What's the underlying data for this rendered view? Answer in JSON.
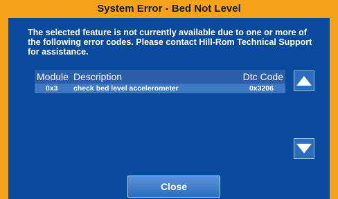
{
  "dialog": {
    "title": "System Error - Bed Not Level",
    "message": "The selected feature is not currently available due to one or more of the following error codes.  Please contact Hill-Rom Technical Support for assistance."
  },
  "table": {
    "headers": [
      "Module",
      "Description",
      "Dtc Code"
    ],
    "rows": [
      {
        "module": "0x3",
        "description": "check bed level accelerometer",
        "dtc": "0x3206"
      }
    ]
  },
  "buttons": {
    "close_label": "Close",
    "scroll_up_icon": "triangle-up-icon",
    "scroll_down_icon": "triangle-down-icon"
  },
  "colors": {
    "title_bar": "#f7a21b",
    "panel": "#0a4a9c",
    "table_header": "#2a5ea8",
    "table_row_selected": "#3f79c4",
    "button": "#2e6cc0"
  }
}
